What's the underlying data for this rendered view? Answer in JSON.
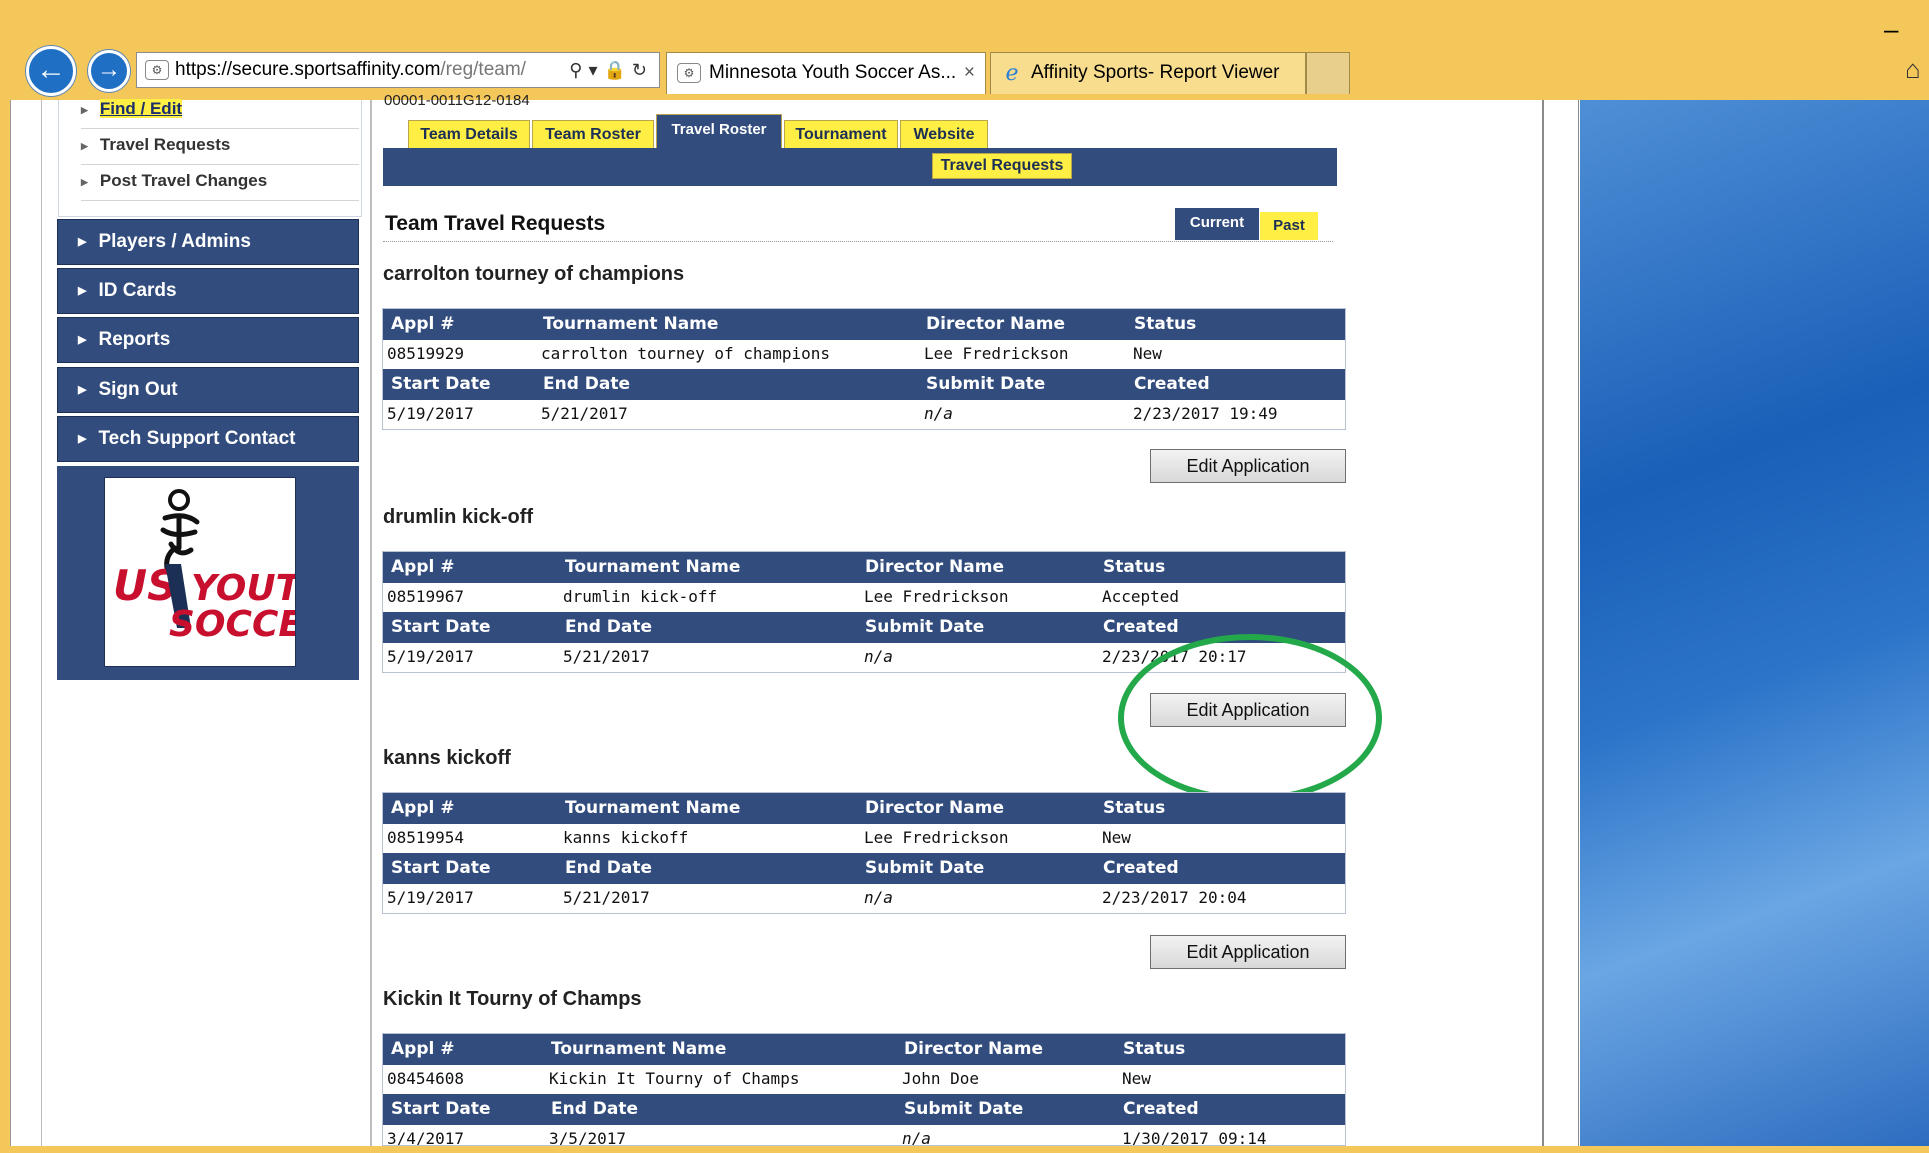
{
  "browser": {
    "url_domain": "https://secure.sportsaffinity.com",
    "url_path": "/reg/team/",
    "tabs": [
      {
        "title": "Minnesota Youth Soccer As...",
        "close": "×"
      },
      {
        "title": "Affinity Sports- Report Viewer"
      }
    ]
  },
  "sidebar": {
    "sub_items": [
      "Find / Edit",
      "Travel Requests",
      "Post Travel Changes"
    ],
    "nav_items": [
      "Players / Admins",
      "ID Cards",
      "Reports",
      "Sign Out",
      "Tech Support Contact"
    ],
    "logo": {
      "line1": "US",
      "line2": "YOUTH",
      "line3": "SOCCER"
    }
  },
  "content": {
    "team_id": "00001-0011G12-0184",
    "tabs": [
      "Team Details",
      "Team Roster",
      "Travel Roster",
      "Tournament",
      "Website"
    ],
    "subtab": "Travel Requests",
    "heading": "Team Travel Requests",
    "view_tabs": {
      "current": "Current",
      "past": "Past"
    },
    "headers_row1": [
      "Appl #",
      "Tournament Name",
      "Director Name",
      "Status"
    ],
    "headers_row2": [
      "Start Date",
      "End Date",
      "Submit Date",
      "Created"
    ],
    "edit_label": "Edit Application",
    "requests": [
      {
        "title": "carrolton tourney of champions",
        "appl": "08519929",
        "name": "carrolton tourney of champions",
        "director": "Lee Fredrickson",
        "status": "New",
        "start": "5/19/2017",
        "end": "5/21/2017",
        "submit": "n/a",
        "created": "2/23/2017 19:49"
      },
      {
        "title": "drumlin kick-off",
        "appl": "08519967",
        "name": "drumlin kick-off",
        "director": "Lee Fredrickson",
        "status": "Accepted",
        "start": "5/19/2017",
        "end": "5/21/2017",
        "submit": "n/a",
        "created": "2/23/2017 20:17"
      },
      {
        "title": "kanns kickoff",
        "appl": "08519954",
        "name": "kanns kickoff",
        "director": "Lee Fredrickson",
        "status": "New",
        "start": "5/19/2017",
        "end": "5/21/2017",
        "submit": "n/a",
        "created": "2/23/2017 20:04"
      },
      {
        "title": "Kickin It Tourny of Champs",
        "appl": "08454608",
        "name": "Kickin It Tourny of Champs",
        "director": "John Doe",
        "status": "New",
        "start": "3/4/2017",
        "end": "3/5/2017",
        "submit": "n/a",
        "created": "1/30/2017 09:14"
      }
    ]
  },
  "colors": {
    "nav": "#324c7d",
    "tab_yellow": "#ffee44",
    "highlight": "#23a84a",
    "chrome": "#f3c75a"
  }
}
